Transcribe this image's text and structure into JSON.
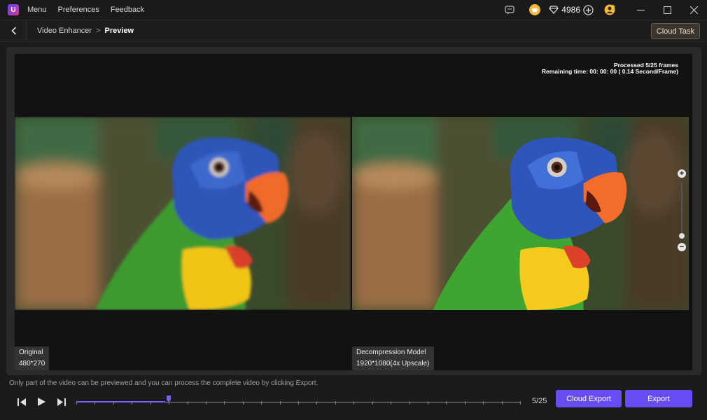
{
  "titlebar": {
    "logo_glyph": "U",
    "menu": [
      "Menu",
      "Preferences",
      "Feedback"
    ],
    "credits": "4986"
  },
  "nav": {
    "breadcrumb_parent": "Video Enhancer",
    "breadcrumb_sep": ">",
    "breadcrumb_current": "Preview",
    "cloud_task_label": "Cloud Task"
  },
  "preview": {
    "processed_text": "Processed 5/25 frames",
    "remaining_text": "Remaining time: 00: 00: 00  ( 0.14 Second/Frame)",
    "left": {
      "title": "Original",
      "resolution": "480*270"
    },
    "right": {
      "title": "Decompression Model",
      "resolution": "1920*1080(4x Upscale)"
    }
  },
  "bottom": {
    "hint": "Only part of the video can be previewed and you can process the complete video by clicking Export.",
    "frame_counter": "5/25",
    "progress_fraction": 0.2,
    "cloud_export_label": "Cloud Export",
    "export_label": "Export"
  },
  "colors": {
    "accent": "#6a4cf5",
    "background": "#1b1b1d",
    "cloud_task_border": "#6b5a3d"
  },
  "icons": [
    "app-logo-icon",
    "message-icon",
    "store-icon",
    "diamond-icon",
    "plus-circle-icon",
    "user-avatar-icon",
    "minimize-icon",
    "maximize-icon",
    "close-icon",
    "back-arrow-icon",
    "zoom-in-icon",
    "zoom-out-icon",
    "prev-frame-icon",
    "play-icon",
    "next-frame-icon"
  ]
}
